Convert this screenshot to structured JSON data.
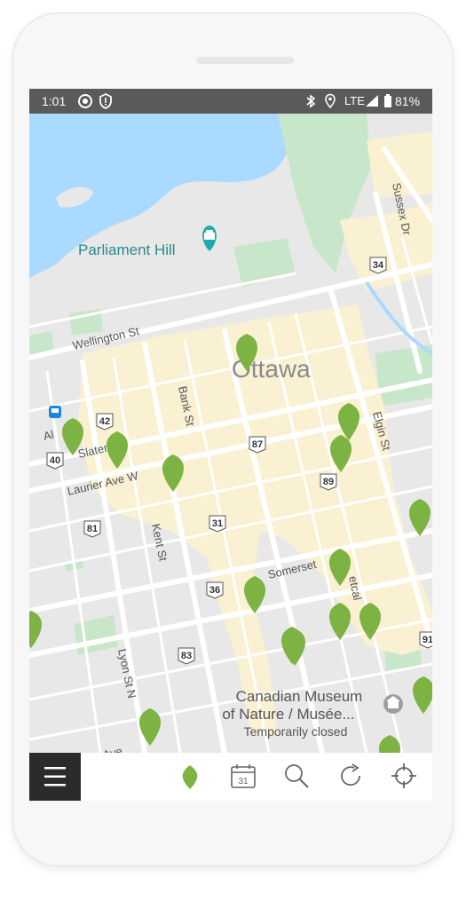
{
  "status": {
    "time": "1:01",
    "network": "LTE",
    "battery": "81%"
  },
  "map": {
    "labels": {
      "parliament": "Parliament Hill",
      "city": "Ottawa",
      "wellington": "Wellington St",
      "bank": "Bank St",
      "slater": "Slater",
      "laurier": "Laurier Ave W",
      "kent": "Kent St",
      "lyon": "Lyon St N",
      "elgin": "Elgin St",
      "sussex": "Sussex Dr",
      "somerset": "Somerset",
      "metcalfe": "etcal",
      "albert": "Al",
      "ave": "Ave",
      "museum_line1": "Canadian Museum",
      "museum_line2": "of Nature / Musée...",
      "museum_status": "Temporarily closed"
    },
    "shields": {
      "s34": "34",
      "s42": "42",
      "s40": "40",
      "s87": "87",
      "s89": "89",
      "s81": "81",
      "s31": "31",
      "s36": "36",
      "s83": "83",
      "s91": "91"
    }
  },
  "toolbar": {
    "calendar_day": "31"
  },
  "colors": {
    "pin": "#7cb342",
    "water": "#aadaff",
    "park": "#c8e6c9",
    "downtown": "#faf0d2",
    "statusbar": "#5a5a5a"
  }
}
